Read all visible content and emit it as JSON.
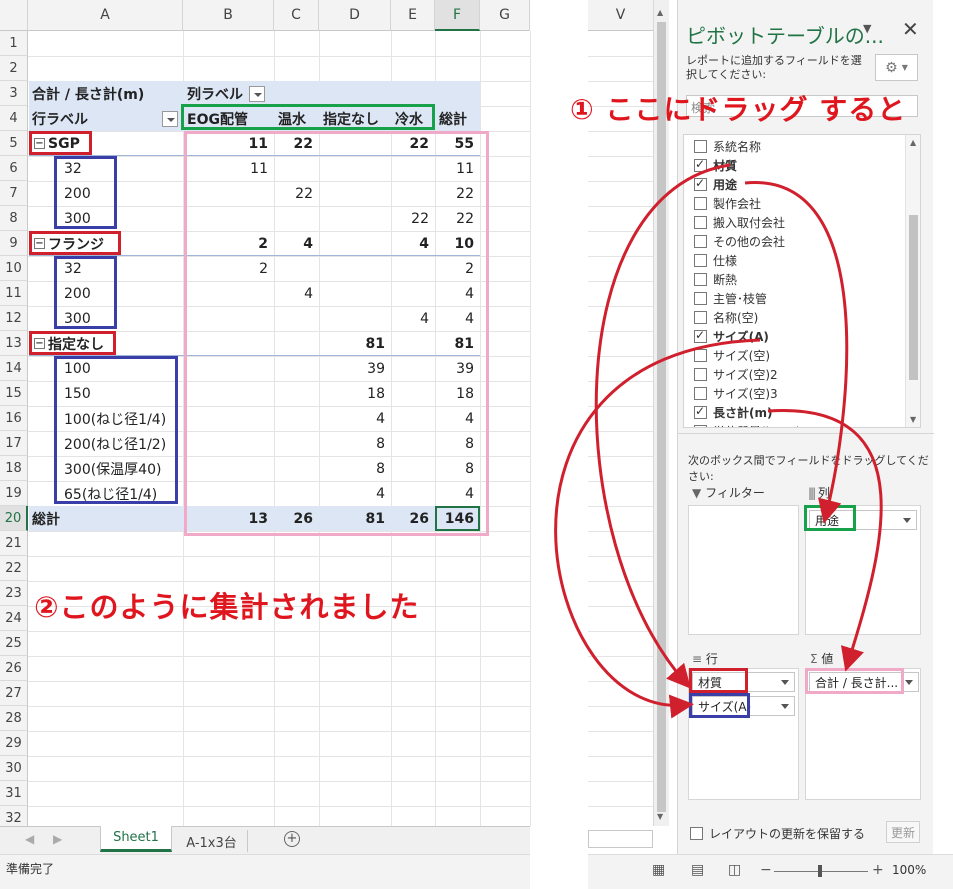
{
  "sheet": {
    "columns": [
      "A",
      "B",
      "C",
      "D",
      "E",
      "F",
      "G"
    ],
    "rows": [
      "1",
      "2",
      "3",
      "4",
      "5",
      "6",
      "7",
      "8",
      "9",
      "10",
      "11",
      "12",
      "13",
      "14",
      "15",
      "16",
      "17",
      "18",
      "19",
      "20",
      "21",
      "22",
      "23",
      "24",
      "25",
      "26",
      "27",
      "28",
      "29",
      "30",
      "31",
      "32"
    ],
    "pivot": {
      "value_header": "合計 / 長さ計(m)",
      "col_label_header": "列ラベル",
      "row_label_header": "行ラベル",
      "columns": [
        "EOG配管",
        "温水",
        "指定なし",
        "冷水",
        "総計"
      ],
      "rows": [
        {
          "label": "SGP",
          "group": true,
          "values": [
            "11",
            "22",
            "",
            "22",
            "55"
          ]
        },
        {
          "label": "32",
          "group": false,
          "values": [
            "11",
            "",
            "",
            "",
            "11"
          ]
        },
        {
          "label": "200",
          "group": false,
          "values": [
            "",
            "22",
            "",
            "",
            "22"
          ]
        },
        {
          "label": "300",
          "group": false,
          "values": [
            "",
            "",
            "",
            "22",
            "22"
          ]
        },
        {
          "label": "フランジ",
          "group": true,
          "values": [
            "2",
            "4",
            "",
            "4",
            "10"
          ]
        },
        {
          "label": "32",
          "group": false,
          "values": [
            "2",
            "",
            "",
            "",
            "2"
          ]
        },
        {
          "label": "200",
          "group": false,
          "values": [
            "",
            "4",
            "",
            "",
            "4"
          ]
        },
        {
          "label": "300",
          "group": false,
          "values": [
            "",
            "",
            "",
            "4",
            "4"
          ]
        },
        {
          "label": "指定なし",
          "group": true,
          "values": [
            "",
            "",
            "81",
            "",
            "81"
          ]
        },
        {
          "label": "100",
          "group": false,
          "values": [
            "",
            "",
            "39",
            "",
            "39"
          ]
        },
        {
          "label": "150",
          "group": false,
          "values": [
            "",
            "",
            "18",
            "",
            "18"
          ]
        },
        {
          "label": "100(ねじ径1/4)",
          "group": false,
          "values": [
            "",
            "",
            "4",
            "",
            "4"
          ]
        },
        {
          "label": "200(ねじ径1/2)",
          "group": false,
          "values": [
            "",
            "",
            "8",
            "",
            "8"
          ]
        },
        {
          "label": "300(保温厚40)",
          "group": false,
          "values": [
            "",
            "",
            "8",
            "",
            "8"
          ]
        },
        {
          "label": "65(ねじ径1/4)",
          "group": false,
          "values": [
            "",
            "",
            "4",
            "",
            "4"
          ]
        }
      ],
      "total_label": "総計",
      "total_values": [
        "13",
        "26",
        "81",
        "26",
        "146"
      ]
    },
    "tabs": [
      "Sheet1",
      "A-1x3台"
    ],
    "status": "準備完了"
  },
  "annotations": {
    "step1": "① ここにドラッグ すると",
    "step2": "②このように集計されました"
  },
  "right_sheet": {
    "column": "V"
  },
  "pane": {
    "title": "ピボットテーブルの...",
    "subtitle": "レポートに追加するフィールドを選択してください:",
    "search_placeholder": "検索",
    "fields": [
      {
        "label": "系統名称",
        "checked": false,
        "bold": false
      },
      {
        "label": "材質",
        "checked": true,
        "bold": true
      },
      {
        "label": "用途",
        "checked": true,
        "bold": true
      },
      {
        "label": "製作会社",
        "checked": false,
        "bold": false
      },
      {
        "label": "搬入取付会社",
        "checked": false,
        "bold": false
      },
      {
        "label": "その他の会社",
        "checked": false,
        "bold": false
      },
      {
        "label": "仕様",
        "checked": false,
        "bold": false
      },
      {
        "label": "断熱",
        "checked": false,
        "bold": false
      },
      {
        "label": "主管･枝管",
        "checked": false,
        "bold": false
      },
      {
        "label": "名称(空)",
        "checked": false,
        "bold": false
      },
      {
        "label": "サイズ(A)",
        "checked": true,
        "bold": true
      },
      {
        "label": "サイズ(空)",
        "checked": false,
        "bold": false
      },
      {
        "label": "サイズ(空)2",
        "checked": false,
        "bold": false
      },
      {
        "label": "サイズ(空)3",
        "checked": false,
        "bold": false
      },
      {
        "label": "長さ計(m)",
        "checked": true,
        "bold": true
      },
      {
        "label": "単位質量(kg/m)",
        "checked": false,
        "bold": false
      }
    ],
    "drag_hint": "次のボックス間でフィールドをドラッグしてください:",
    "filter_label": "フィルター",
    "columns_label": "列",
    "rows_label": "行",
    "values_label": "値",
    "columns_chips": [
      "用途"
    ],
    "rows_chips": [
      "材質",
      "サイズ(A)"
    ],
    "values_chips": [
      "合計 / 長さ計..."
    ],
    "defer_label": "レイアウトの更新を保留する",
    "update_button": "更新"
  },
  "statusbar": {
    "zoom": "100%"
  },
  "colors": {
    "red": "#d0202d",
    "blue": "#3a3fa8",
    "green": "#17a14a",
    "pink": "#f0a9c6",
    "excel_green": "#217346"
  }
}
